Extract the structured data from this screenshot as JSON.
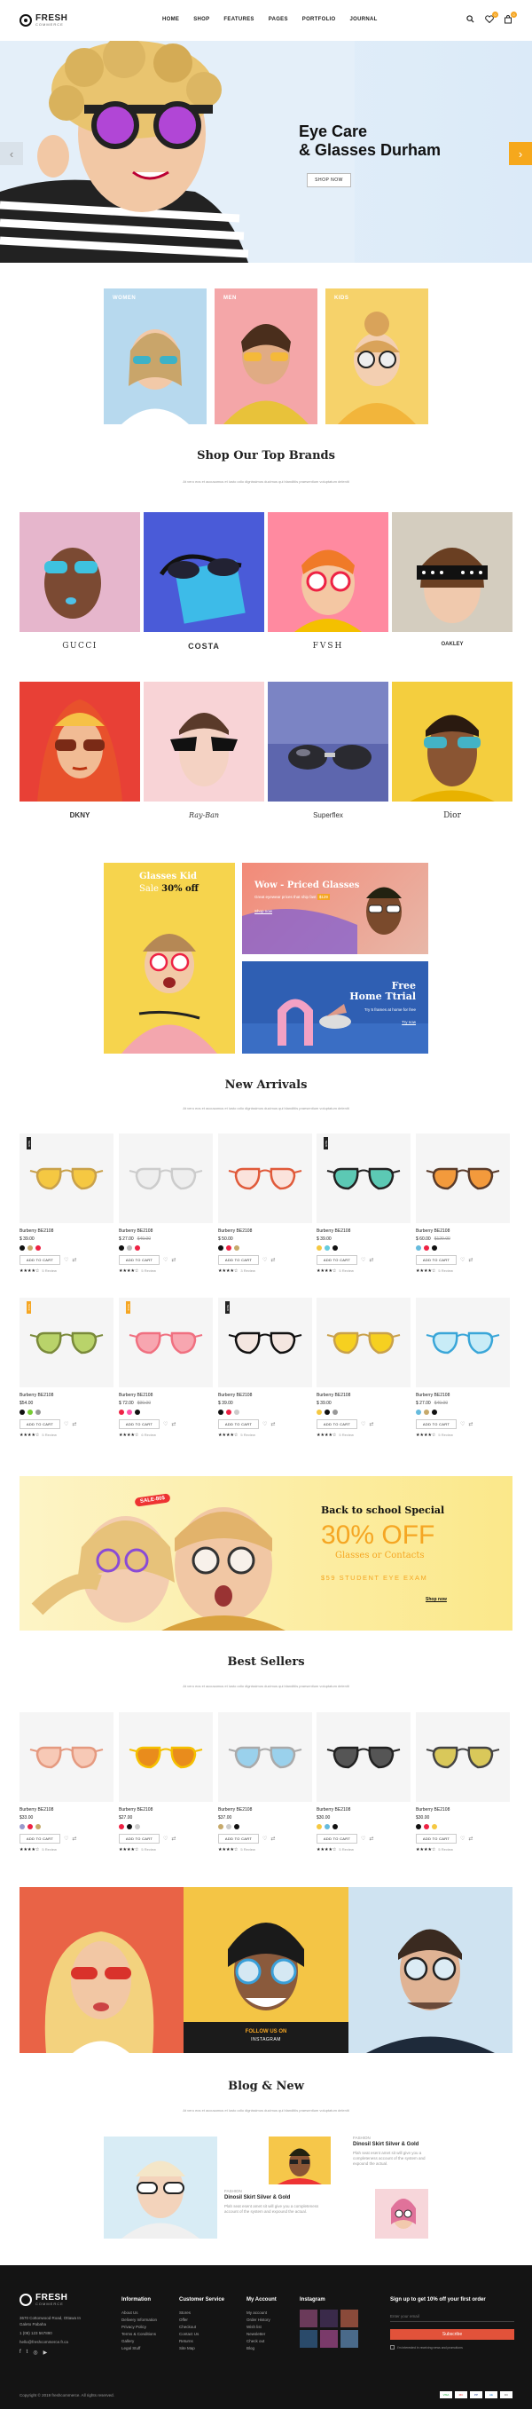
{
  "brand": {
    "name": "FRESH",
    "tagline": "COMMERCE"
  },
  "nav": [
    "HOME",
    "SHOP",
    "FEATURES",
    "PAGES",
    "PORTFOLIO",
    "JOURNAL"
  ],
  "header_icons": {
    "cart_count": "0",
    "wishlist_count": "0"
  },
  "hero": {
    "title_line1": "Eye Care",
    "title_line2": "& Glasses Durham",
    "button": "SHOP NOW",
    "prev": "‹",
    "next": "›"
  },
  "categories": [
    {
      "label": "WOMEN"
    },
    {
      "label": "MEN"
    },
    {
      "label": "KIDS"
    }
  ],
  "brands_section": {
    "title": "Shop Our Top Brands",
    "subtitle": "At vero eos et accusamus et iusto odio dignissimos ducimus qui blanditiis praesentium voluptatum deleniti"
  },
  "brands": [
    "GUCCI",
    "COSTA",
    "FVSH",
    "OAKLEY",
    "DKNY",
    "Ray-Ban",
    "Superflex",
    "Dior"
  ],
  "promos": {
    "kids_title": "Glasses Kid",
    "kids_sale_prefix": "Sale ",
    "kids_sale_value": "30% off",
    "wow_title": "Wow - Priced Glasses",
    "wow_sub": "Great eyewear prices that ship fast",
    "wow_price": "$129",
    "wow_link": "Shop now",
    "trial_title_1": "Free",
    "trial_title_2": "Home Ttrial",
    "trial_sub": "Try 5 frames at home for free",
    "trial_link": "Try now"
  },
  "new_arrivals": {
    "title": "New Arrivals",
    "subtitle": "At vero eos et accusamus et iusto odio dignissimos ducimus qui blanditiis praesentium voluptatum deleniti",
    "add_to_cart": "ADD TO CART",
    "products": [
      {
        "name": "Burberry BE2108",
        "price": "$ 39.00",
        "old": "",
        "tag": "NEW",
        "tagc": "#222",
        "colors": [
          "#111",
          "#c6a96b",
          "#e24"
        ],
        "reviews": "5 Review",
        "glass": "#f5c842",
        "frame": "#c9a14a"
      },
      {
        "name": "Burberry BE2108",
        "price": "$ 27.00",
        "old": "$49.00",
        "tag": "",
        "tagc": "",
        "colors": [
          "#111",
          "#bbb",
          "#e24"
        ],
        "reviews": "5 Review",
        "glass": "#eee",
        "frame": "#ccc"
      },
      {
        "name": "Burberry BE2108",
        "price": "$ 50.00",
        "old": "",
        "tag": "",
        "tagc": "",
        "colors": [
          "#111",
          "#e24",
          "#c6a96b"
        ],
        "reviews": "3 Review",
        "glass": "#fbe3dc",
        "frame": "#e05a3a"
      },
      {
        "name": "Burberry BE2108",
        "price": "$ 39.00",
        "old": "",
        "tag": "NEW",
        "tagc": "#222",
        "colors": [
          "#f5c842",
          "#6cd",
          "#111"
        ],
        "reviews": "5 Review",
        "glass": "#5cc9b4",
        "frame": "#222"
      },
      {
        "name": "Burberry BE2108",
        "price": "$ 60.00",
        "old": "$120.00",
        "tag": "",
        "tagc": "",
        "colors": [
          "#6bd",
          "#e24",
          "#111"
        ],
        "reviews": "5 Review",
        "glass": "#f39a3c",
        "frame": "#5a3b2a"
      },
      {
        "name": "Burberry BE2108",
        "price": "$54.00",
        "old": "",
        "tag": "SALE",
        "tagc": "#f5a623",
        "colors": [
          "#111",
          "#7c3",
          "#999"
        ],
        "reviews": "5 Review",
        "glass": "#b9d36a",
        "frame": "#7a8a3a"
      },
      {
        "name": "Burberry BE2108",
        "price": "$ 72.00",
        "old": "$90.00",
        "tag": "SALE",
        "tagc": "#f5a623",
        "colors": [
          "#e24",
          "#f5a",
          "#111"
        ],
        "reviews": "6 Review",
        "glass": "#f7a6b0",
        "frame": "#f07080"
      },
      {
        "name": "Burberry BE2108",
        "price": "$ 39.00",
        "old": "",
        "tag": "NEW",
        "tagc": "#222",
        "colors": [
          "#111",
          "#e24",
          "#ccc"
        ],
        "reviews": "5 Review",
        "glass": "#f4e6e0",
        "frame": "#111"
      },
      {
        "name": "Burberry BE2108",
        "price": "$ 39.00",
        "old": "",
        "tag": "",
        "tagc": "",
        "colors": [
          "#f5c842",
          "#111",
          "#999"
        ],
        "reviews": "5 Review",
        "glass": "#f6d020",
        "frame": "#c9a14a"
      },
      {
        "name": "Burberry BE2108",
        "price": "$ 27.00",
        "old": "$49.00",
        "tag": "",
        "tagc": "",
        "colors": [
          "#6bd",
          "#c6a96b",
          "#111"
        ],
        "reviews": "5 Review",
        "glass": "#c8ecf7",
        "frame": "#3aa6d8"
      }
    ]
  },
  "school_banner": {
    "sale": "SALE-80$",
    "title": "Back to school Special",
    "percent": "30% OFF",
    "sub": "Glasses or Contacts",
    "exam": "$59 STUDENT EYE EXAM",
    "button": "Shop now"
  },
  "best_sellers": {
    "title": "Best Sellers",
    "subtitle": "At vero eos et accusamus et iusto odio dignissimos ducimus qui blanditiis praesentium voluptatum deleniti",
    "add_to_cart": "ADD TO CART",
    "products": [
      {
        "name": "Burberry BE2108",
        "price": "$33.00",
        "old": "",
        "colors": [
          "#99c",
          "#e24",
          "#c6a96b"
        ],
        "reviews": "5 Review",
        "glass": "#f7c9b6",
        "frame": "#e59a80"
      },
      {
        "name": "Burberry BE2108",
        "price": "$27.00",
        "old": "",
        "colors": [
          "#e24",
          "#111",
          "#ccc"
        ],
        "reviews": "5 Review",
        "glass": "#e98c1c",
        "frame": "#f5c000"
      },
      {
        "name": "Burberry BE2108",
        "price": "$37.00",
        "old": "",
        "colors": [
          "#c6a96b",
          "#ccc",
          "#111"
        ],
        "reviews": "5 Review",
        "glass": "#9ad1ec",
        "frame": "#aaa"
      },
      {
        "name": "Burberry BE2108",
        "price": "$30.00",
        "old": "",
        "colors": [
          "#f5c842",
          "#6bd",
          "#111"
        ],
        "reviews": "5 Review",
        "glass": "#555",
        "frame": "#222"
      },
      {
        "name": "Burberry BE2108",
        "price": "$30.00",
        "old": "",
        "colors": [
          "#111",
          "#e24",
          "#f5c842"
        ],
        "reviews": "5 Review",
        "glass": "#d9c85a",
        "frame": "#444"
      }
    ]
  },
  "instagram": {
    "follow": "FOLLOW US ON",
    "handle": "INSTAGRAM"
  },
  "blog": {
    "title": "Blog & New",
    "subtitle": "At vero eos et accusamus et iusto odio dignissimos ducimus qui blanditiis praesentium voluptatum deleniti",
    "posts": [
      {
        "cat": "FASHION",
        "title": "Dinosil Skirt Silver & Gold",
        "text": "Plah seat esent amet sit will give you a completeness account of the system and expound the actual."
      },
      {
        "cat": "FASHION",
        "title": "Dinosil Skirt Silver & Gold",
        "text": "Plah seat esent amet sit will give you a completeness account of the system and expound the actual."
      }
    ]
  },
  "footer": {
    "address": "3670 Cottonwood Road, Ottawa In Galeto Pabaha",
    "phone": "1 (08) 123 567890",
    "email": "hello@freshcommerce.fr.ca",
    "cols": [
      {
        "title": "Information",
        "items": [
          "About Us",
          "Delivery Information",
          "Privacy Policy",
          "Terms & Conditions",
          "Gallery",
          "Legal Stuff"
        ]
      },
      {
        "title": "Customer Service",
        "items": [
          "Stores",
          "Offer",
          "Checkout",
          "Contact Us",
          "Returns",
          "Site Map"
        ]
      },
      {
        "title": "My Account",
        "items": [
          "My account",
          "Order History",
          "Wish list",
          "Newsletter",
          "Check out",
          "Blog"
        ]
      }
    ],
    "instagram_title": "Instagram",
    "newsletter_title": "Sign up to get 10% off your first order",
    "newsletter_placeholder": "Enter your email",
    "subscribe": "Subscribe",
    "newsletter_check": "I'm interested in receiving news and promotions",
    "copyright": "Copyright © 2019 freshcommerce. All rights reserved.",
    "payments": [
      "VISA",
      "MC",
      "PP",
      "AE",
      "DC"
    ]
  }
}
